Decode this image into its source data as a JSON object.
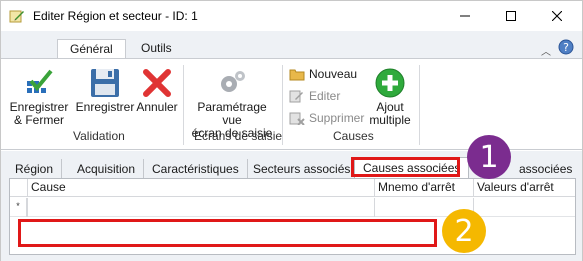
{
  "window": {
    "title": "Editer Région et secteur - ID: 1"
  },
  "ribbon": {
    "tabs": [
      {
        "label": "Général",
        "active": true
      },
      {
        "label": "Outils",
        "active": false
      }
    ],
    "groups": {
      "validation": {
        "label": "Validation",
        "buttons": [
          {
            "label_line1": "Enregistrer",
            "label_line2": "& Fermer",
            "icon": "save-close-icon"
          },
          {
            "label_line1": "Enregistrer",
            "label_line2": "",
            "icon": "save-icon"
          },
          {
            "label_line1": "Annuler",
            "label_line2": "",
            "icon": "cancel-icon"
          }
        ]
      },
      "ecrans": {
        "label": "Ecrans de saisie",
        "button": {
          "label_line1": "Paramétrage vue",
          "label_line2": "écran de saisie",
          "icon": "gears-icon"
        }
      },
      "causes": {
        "label": "Causes",
        "small_buttons": [
          {
            "label": "Nouveau",
            "icon": "folder-new-icon",
            "enabled": true
          },
          {
            "label": "Editer",
            "icon": "edit-icon",
            "enabled": false
          },
          {
            "label": "Supprimer",
            "icon": "delete-icon",
            "enabled": false
          }
        ],
        "add_multiple": {
          "label_line1": "Ajout",
          "label_line2": "multiple",
          "icon": "add-icon"
        }
      }
    }
  },
  "detail_tabs": [
    {
      "label": "Région",
      "active": false
    },
    {
      "label": "Acquisition",
      "active": false
    },
    {
      "label": "Caractéristiques",
      "active": false
    },
    {
      "label": "Secteurs associés",
      "active": false
    },
    {
      "label": "Causes associées",
      "active": true
    },
    {
      "label": "associées",
      "active": false
    }
  ],
  "grid": {
    "columns": [
      "Cause",
      "Mnemo d'arrêt",
      "Valeurs d'arrêt"
    ],
    "new_row_indicator": "*"
  },
  "annotations": [
    {
      "number": "1",
      "color": "#7b2c8f"
    },
    {
      "number": "2",
      "color": "#f5b800"
    }
  ],
  "colors": {
    "highlight": "#e01818",
    "ribbon_bg": "#eef1f5"
  }
}
